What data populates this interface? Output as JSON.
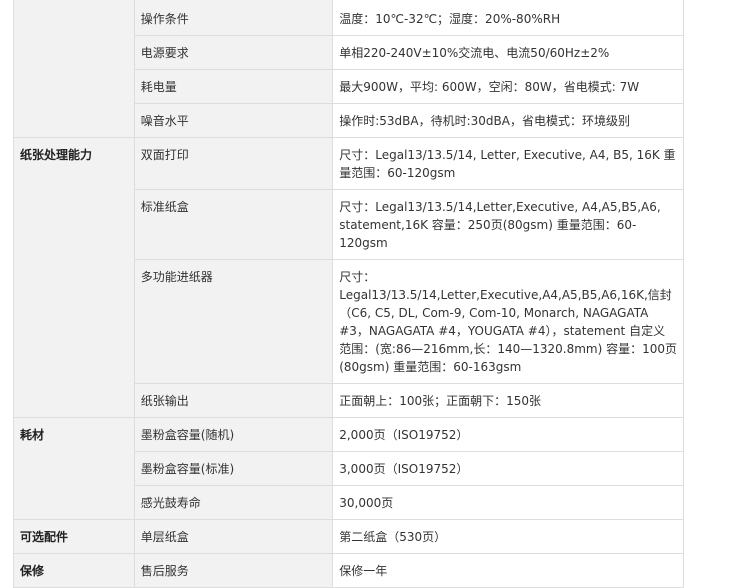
{
  "rows": [
    {
      "category": "",
      "item": "操作条件",
      "value": "温度：10℃-32℃；湿度：20%-80%RH"
    },
    {
      "category": "",
      "item": "电源要求",
      "value": "单相220-240V±10%交流电、电流50/60Hz±2%"
    },
    {
      "category": "",
      "item": "耗电量",
      "value": "最大900W，平均: 600W，空闲：80W，省电模式: 7W"
    },
    {
      "category": "",
      "item": "噪音水平",
      "value": "操作时:53dBA，待机时:30dBA，省电模式：环境级别"
    },
    {
      "category": "纸张处理能力",
      "item": "双面打印",
      "value": "尺寸：Legal13/13.5/14, Letter, Executive, A4, B5, 16K 重量范围：60-120gsm"
    },
    {
      "category": "",
      "item": "标准纸盒",
      "value": "尺寸：Legal13/13.5/14,Letter,Executive, A4,A5,B5,A6, statement,16K 容量：250页(80gsm) 重量范围：60-120gsm"
    },
    {
      "category": "",
      "item": "多功能进纸器",
      "value": "尺寸：Legal13/13.5/14,Letter,Executive,A4,A5,B5,A6,16K,信封（C6, C5, DL, Com-9, Com-10, Monarch, NAGAGATA #3，NAGAGATA #4，YOUGATA #4），statement 自定义范围：(宽:86—216mm,长：140—1320.8mm) 容量：100页(80gsm) 重量范围：60-163gsm"
    },
    {
      "category": "",
      "item": "纸张输出",
      "value": "正面朝上：100张；正面朝下：150张"
    },
    {
      "category": "耗材",
      "item": "墨粉盒容量(随机)",
      "value": "2,000页（ISO19752）"
    },
    {
      "category": "",
      "item": "墨粉盒容量(标准)",
      "value": "3,000页（ISO19752）"
    },
    {
      "category": "",
      "item": "感光鼓寿命",
      "value": "30,000页"
    },
    {
      "category": "可选配件",
      "item": "单层纸盒",
      "value": "第二纸盒（530页）"
    },
    {
      "category": "保修",
      "item": "售后服务",
      "value": "保修一年"
    }
  ]
}
